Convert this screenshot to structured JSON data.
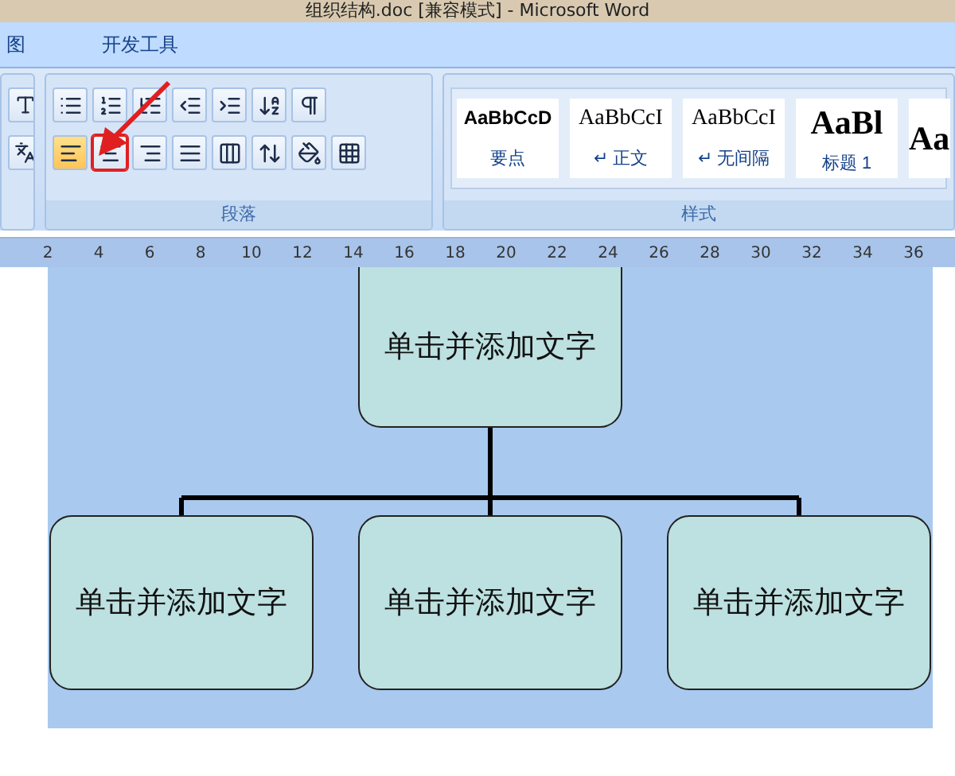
{
  "window": {
    "title": "组织结构.doc [兼容模式] - Microsoft Word"
  },
  "ribbon_tabs": [
    {
      "label": "图"
    },
    {
      "label": "开发工具"
    }
  ],
  "paragraph_group": {
    "label": "段落",
    "alignment": [
      {
        "kind": "left",
        "selected": true,
        "highlighted": false
      },
      {
        "kind": "center",
        "selected": false,
        "highlighted": true
      },
      {
        "kind": "right",
        "selected": false,
        "highlighted": false
      },
      {
        "kind": "justify",
        "selected": false,
        "highlighted": false
      },
      {
        "kind": "distributed",
        "selected": false,
        "highlighted": false
      }
    ]
  },
  "styles_group": {
    "label": "样式",
    "items": [
      {
        "preview": "AaBbCcD",
        "name": "要点",
        "kind": "bold-sans"
      },
      {
        "preview": "AaBbCcI",
        "name": "↵ 正文",
        "kind": "serif"
      },
      {
        "preview": "AaBbCcI",
        "name": "↵ 无间隔",
        "kind": "serif"
      },
      {
        "preview": "AaBl",
        "name": "标题 1",
        "kind": "heading"
      },
      {
        "preview": "Aa",
        "kind": "heading"
      }
    ]
  },
  "ruler": {
    "ticks": [
      "2",
      "4",
      "6",
      "8",
      "10",
      "12",
      "14",
      "16",
      "18",
      "20",
      "22",
      "24",
      "26",
      "28",
      "30",
      "32",
      "34",
      "36"
    ]
  },
  "diagram": {
    "root": {
      "text": "单击并添加文字"
    },
    "children": [
      {
        "text": "单击并添加文字"
      },
      {
        "text": "单击并添加文字"
      },
      {
        "text": "单击并添加文字"
      }
    ]
  }
}
